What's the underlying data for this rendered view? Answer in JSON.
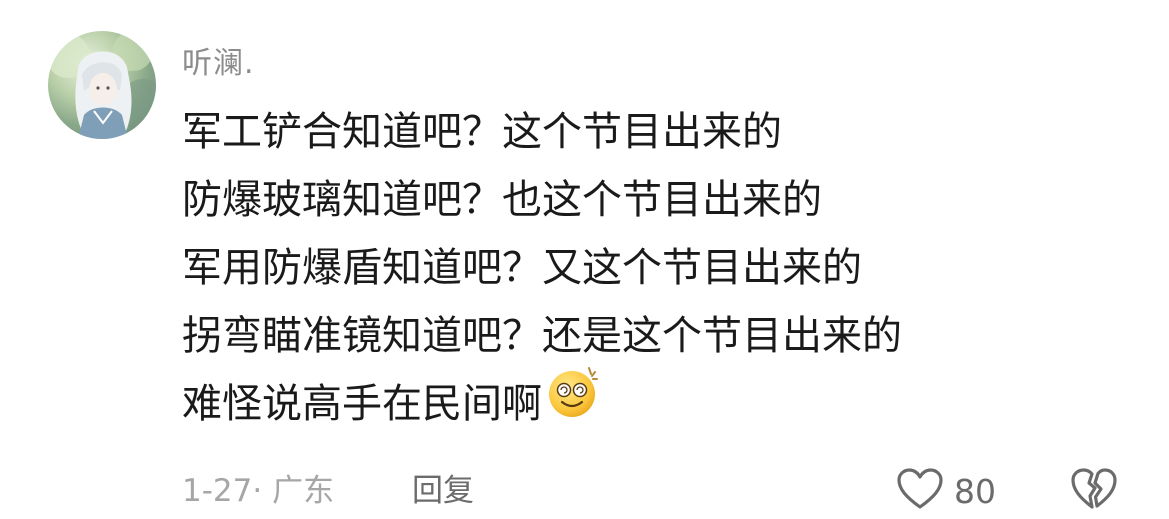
{
  "comment": {
    "username": "听澜.",
    "lines": [
      "军工铲合知道吧？这个节目出来的",
      "防爆玻璃知道吧？也这个节目出来的",
      "军用防爆盾知道吧？又这个节目出来的",
      "拐弯瞄准镜知道吧？还是这个节目出来的",
      "难怪说高手在民间啊"
    ],
    "date_location": "1-27· 广东",
    "reply_label": "回复",
    "like_count": "80",
    "icons": {
      "avatar": "user-avatar",
      "emoji": "dizzy-smile-emoji-icon",
      "like": "heart-outline-icon",
      "dislike": "broken-heart-icon"
    },
    "colors": {
      "text": "#1a1a1a",
      "muted": "#a6a6a6",
      "secondary": "#6b6b6b",
      "username": "#8c8c8c"
    }
  }
}
